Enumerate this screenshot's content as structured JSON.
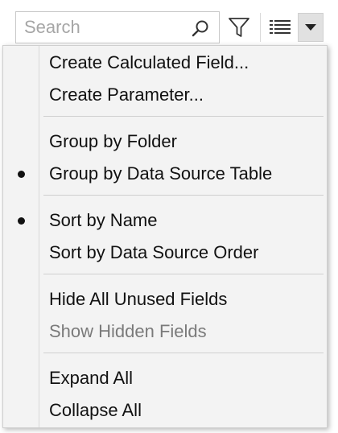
{
  "toolbar": {
    "search_placeholder": "Search",
    "search_icon": "magnifier-icon",
    "filter_icon": "funnel-icon",
    "view_icon": "list-view-icon",
    "menu_icon": "chevron-down-icon"
  },
  "menu": {
    "groups": [
      {
        "items": [
          {
            "label": "Create Calculated Field...",
            "checked": false,
            "enabled": true
          },
          {
            "label": "Create Parameter...",
            "checked": false,
            "enabled": true
          }
        ]
      },
      {
        "items": [
          {
            "label": "Group by Folder",
            "checked": false,
            "enabled": true
          },
          {
            "label": "Group by Data Source Table",
            "checked": true,
            "enabled": true
          }
        ]
      },
      {
        "items": [
          {
            "label": "Sort by Name",
            "checked": true,
            "enabled": true
          },
          {
            "label": "Sort by Data Source Order",
            "checked": false,
            "enabled": true
          }
        ]
      },
      {
        "items": [
          {
            "label": "Hide All Unused Fields",
            "checked": false,
            "enabled": true
          },
          {
            "label": "Show Hidden Fields",
            "checked": false,
            "enabled": false
          }
        ]
      },
      {
        "items": [
          {
            "label": "Expand All",
            "checked": false,
            "enabled": true
          },
          {
            "label": "Collapse All",
            "checked": false,
            "enabled": true
          }
        ]
      }
    ]
  },
  "colors": {
    "menu_background": "#f3f3f3",
    "text": "#111111",
    "disabled_text": "#7a7a7a",
    "placeholder": "#a6a6a6"
  }
}
